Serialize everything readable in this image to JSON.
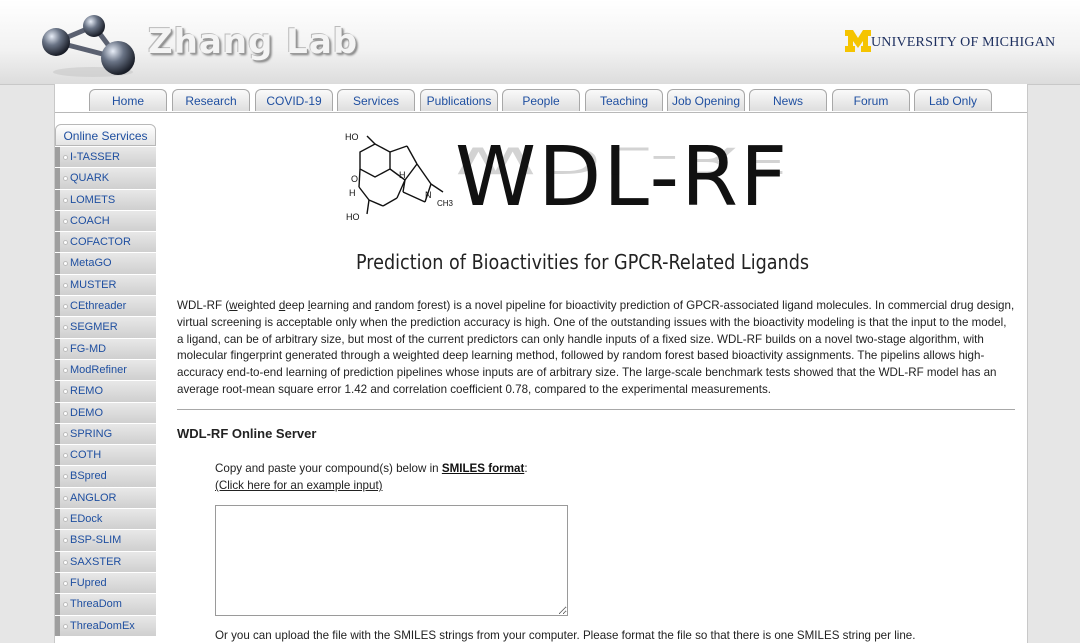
{
  "header": {
    "lab_name": "Zhang Lab",
    "university": "UNIVERSITY OF MICHIGAN",
    "university_logo": "M",
    "colors": {
      "um_maize": "#f5c400",
      "um_blue": "#1c2e5e"
    }
  },
  "nav": {
    "tabs": [
      {
        "label": "Home"
      },
      {
        "label": "Research"
      },
      {
        "label": "COVID-19"
      },
      {
        "label": "Services"
      },
      {
        "label": "Publications"
      },
      {
        "label": "People"
      },
      {
        "label": "Teaching"
      },
      {
        "label": "Job Opening"
      },
      {
        "label": "News"
      },
      {
        "label": "Forum"
      },
      {
        "label": "Lab Only"
      }
    ]
  },
  "sidebar": {
    "header": "Online Services",
    "items": [
      {
        "label": "I-TASSER"
      },
      {
        "label": "QUARK"
      },
      {
        "label": "LOMETS"
      },
      {
        "label": "COACH"
      },
      {
        "label": "COFACTOR"
      },
      {
        "label": "MetaGO"
      },
      {
        "label": "MUSTER"
      },
      {
        "label": "CEthreader"
      },
      {
        "label": "SEGMER"
      },
      {
        "label": "FG-MD"
      },
      {
        "label": "ModRefiner"
      },
      {
        "label": "REMO"
      },
      {
        "label": "DEMO"
      },
      {
        "label": "SPRING"
      },
      {
        "label": "COTH"
      },
      {
        "label": "BSpred"
      },
      {
        "label": "ANGLOR"
      },
      {
        "label": "EDock"
      },
      {
        "label": "BSP-SLIM"
      },
      {
        "label": "SAXSTER"
      },
      {
        "label": "FUpred"
      },
      {
        "label": "ThreaDom"
      },
      {
        "label": "ThreaDomEx"
      }
    ]
  },
  "banner": {
    "title": "WDL-RF",
    "subtitle": "Prediction of Bioactivities for GPCR-Related Ligands",
    "molecule_labels": {
      "oh_top": "HO",
      "oh_bottom": "HO",
      "o": "O",
      "h1": "H",
      "h2": "H",
      "n": "N",
      "ch3": "CH3"
    }
  },
  "description": {
    "p0": "WDL-RF (",
    "w": "w",
    "p1": "eighted ",
    "d": "d",
    "p2": "eep ",
    "l": "l",
    "p3": "earning and ",
    "r": "r",
    "p4": "andom ",
    "f": "f",
    "p5": "orest) is a novel pipeline for bioactivity prediction of GPCR-associated ligand molecules. In commercial drug design, virtual screening is acceptable only when the prediction accuracy is high. One of the outstanding issues with the bioactivity modeling is that the input to the model, a ligand, can be of arbitrary size, but most of the current predictors can only handle inputs of a fixed size. WDL-RF builds on a novel two-stage algorithm, with molecular fingerprint generated through a weighted deep learning method, followed by random forest based bioactivity assignments. The pipelins allows high-accuracy end-to-end learning of prediction pipelines whose inputs are of arbitrary size. The large-scale benchmark tests showed that the WDL-RF model has an average root-mean square error 1.42 and correlation coefficient 0.78, compared to the experimental measurements."
  },
  "server": {
    "title": "WDL-RF Online Server",
    "copy_prefix": "Copy and paste your compound(s) below in ",
    "smiles_link": "SMILES format",
    "copy_suffix": ":",
    "example_link": "(Click here for an example input)",
    "input_value": "",
    "upload_text": "Or you can upload the file with the SMILES strings from your computer. Please format the file so that there is one SMILES string per line."
  }
}
